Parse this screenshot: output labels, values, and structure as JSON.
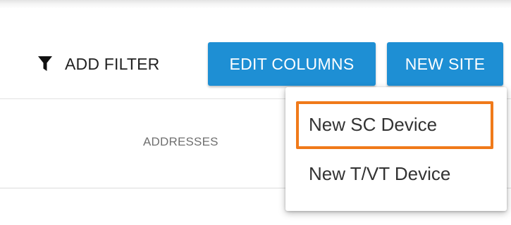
{
  "toolbar": {
    "add_filter_label": "ADD FILTER",
    "edit_columns_label": "EDIT COLUMNS",
    "new_site_label": "NEW SITE",
    "filter_icon": "filter-icon",
    "button_color": "#1e8fd4"
  },
  "table": {
    "columns": [
      "ADDRESSES"
    ]
  },
  "dropdown": {
    "items": [
      {
        "label": "New SC Device",
        "highlighted": true
      },
      {
        "label": "New T/VT Device",
        "highlighted": false
      }
    ],
    "highlight_color": "#f07a1a"
  }
}
